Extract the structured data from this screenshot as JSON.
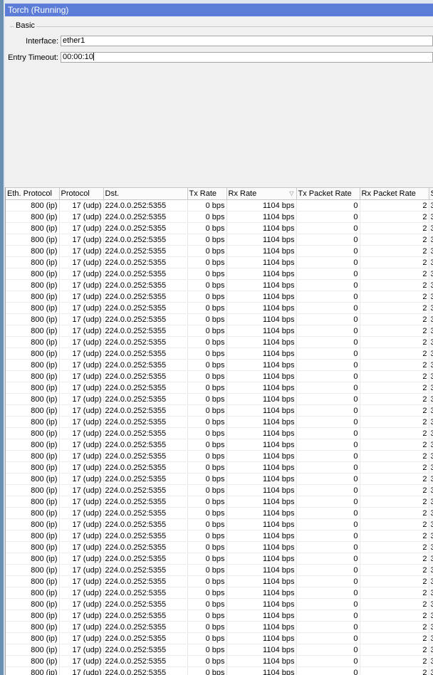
{
  "window": {
    "title": "Torch (Running)"
  },
  "basic": {
    "group_label": "Basic",
    "interface_label": "Interface:",
    "interface_value": "ether1",
    "entry_timeout_label": "Entry Timeout:",
    "entry_timeout_value": "00:00:10"
  },
  "table": {
    "columns": [
      "Eth. Protocol",
      "Protocol",
      "Dst.",
      "Tx Rate",
      "Rx Rate",
      "Tx Packet Rate",
      "Rx Packet Rate",
      "S"
    ],
    "sorted_column_icon": "sort-descending-icon",
    "row": {
      "eth_protocol": "800 (ip)",
      "protocol": "17 (udp)",
      "dst": "224.0.0.252:5355",
      "tx_rate": "0 bps",
      "rx_rate": "1104 bps",
      "tx_packet_rate": "0",
      "rx_packet_rate": "2",
      "extra": "3"
    },
    "visible_row_count": 44
  }
}
